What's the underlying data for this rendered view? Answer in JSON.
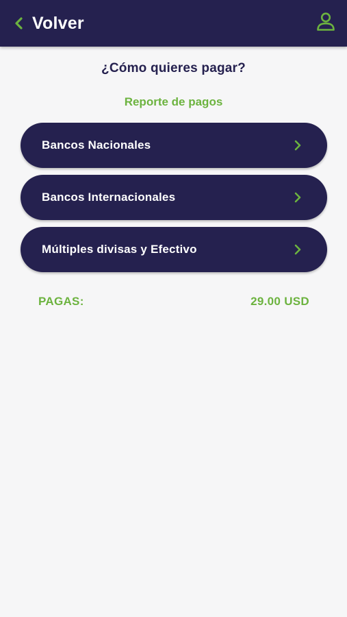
{
  "header": {
    "back_label": "Volver",
    "back_icon": "chevron-left-icon",
    "profile_icon": "user-icon"
  },
  "main": {
    "title": "¿Cómo quieres pagar?",
    "report_link": "Reporte de pagos",
    "options": [
      {
        "label": "Bancos Nacionales",
        "icon": "chevron-right-icon"
      },
      {
        "label": "Bancos Internacionales",
        "icon": "chevron-right-icon"
      },
      {
        "label": "Múltiples divisas y Efectivo",
        "icon": "chevron-right-icon"
      }
    ],
    "total": {
      "label": "PAGAS:",
      "amount": "29.00 USD"
    }
  },
  "colors": {
    "primary": "#25214f",
    "accent": "#6cb33f",
    "background": "#f6f6f7",
    "text_on_primary": "#ffffff"
  }
}
